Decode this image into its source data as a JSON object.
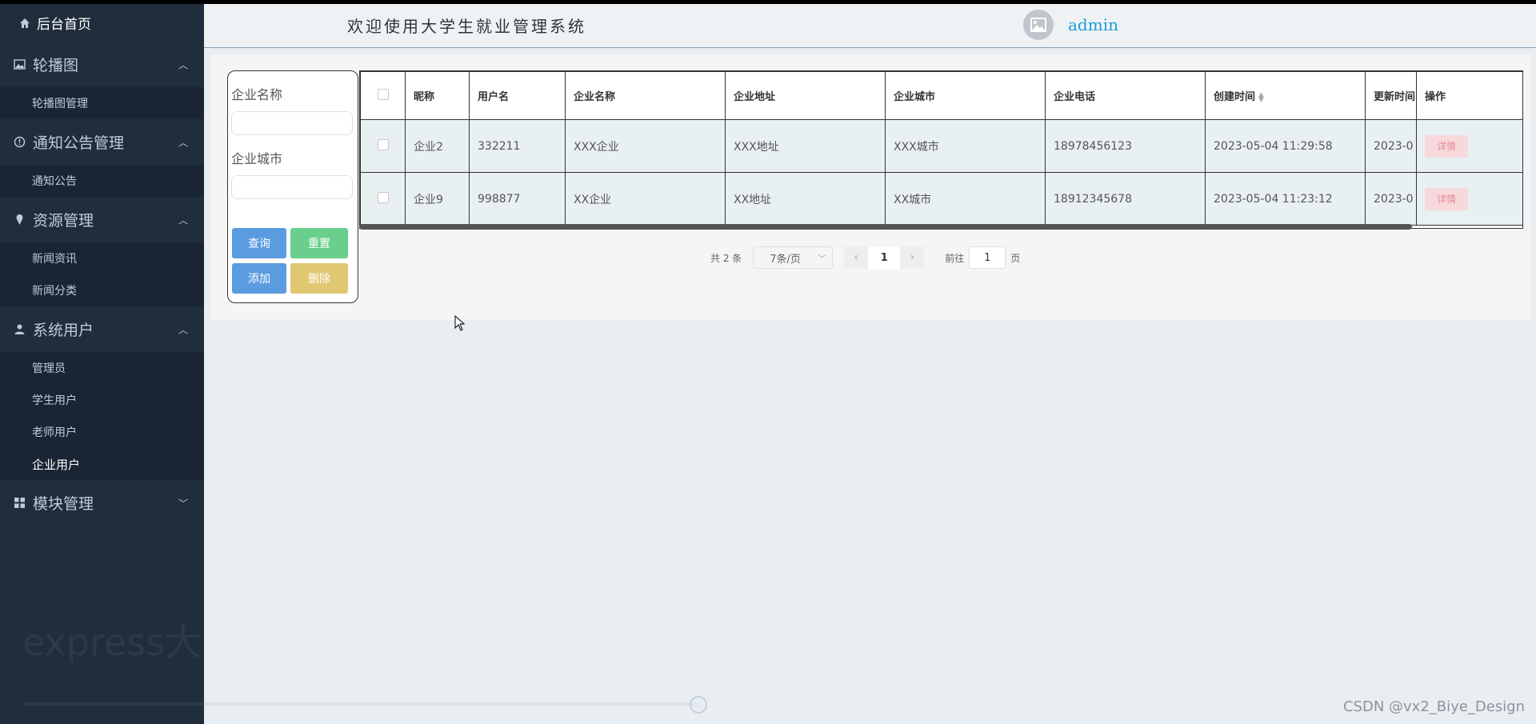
{
  "app": {
    "header_title": "欢迎使用大学生就业管理系统",
    "user_name": "admin"
  },
  "sidebar": {
    "home": "后台首页",
    "groups": [
      {
        "label": "轮播图",
        "icon": "image-icon",
        "expanded": true,
        "items": [
          "轮播图管理"
        ]
      },
      {
        "label": "通知公告管理",
        "icon": "info-circle-icon",
        "expanded": true,
        "items": [
          "通知公告"
        ]
      },
      {
        "label": "资源管理",
        "icon": "pin-icon",
        "expanded": true,
        "items": [
          "新闻资讯",
          "新闻分类"
        ]
      },
      {
        "label": "系统用户",
        "icon": "user-icon",
        "expanded": true,
        "items": [
          "管理员",
          "学生用户",
          "老师用户",
          "企业用户"
        ]
      },
      {
        "label": "模块管理",
        "icon": "grid-icon",
        "expanded": false,
        "items": []
      }
    ],
    "active_item": "企业用户",
    "watermark": "express大学生就业管理系统"
  },
  "search": {
    "company_name_label": "企业名称",
    "company_city_label": "企业城市",
    "company_name_value": "",
    "company_city_value": "",
    "query_label": "查询",
    "reset_label": "重置",
    "add_label": "添加",
    "delete_label": "删除"
  },
  "table": {
    "columns": [
      "昵称",
      "用户名",
      "企业名称",
      "企业地址",
      "企业城市",
      "企业电话",
      "创建时间",
      "更新时间",
      "操作"
    ],
    "rows": [
      {
        "nickname": "企业2",
        "username": "332211",
        "company_name": "XXX企业",
        "address": "XXX地址",
        "city": "XXX城市",
        "phone": "18978456123",
        "created": "2023-05-04 11:29:58",
        "updated": "2023-0"
      },
      {
        "nickname": "企业9",
        "username": "998877",
        "company_name": "XX企业",
        "address": "XX地址",
        "city": "XX城市",
        "phone": "18912345678",
        "created": "2023-05-04 11:23:12",
        "updated": "2023-0"
      }
    ],
    "detail_label": "详情"
  },
  "pagination": {
    "total": "共 2 条",
    "page_size": "7条/页",
    "current_page": "1",
    "goto_prefix": "前往",
    "goto_value": "1",
    "goto_suffix": "页"
  },
  "footer": {
    "credit": "CSDN @vx2_Biye_Design"
  },
  "colors": {
    "sidebar_bg": "#1f2d3d",
    "accent_blue": "#5b9be0",
    "accent_green": "#6acf8c",
    "accent_yellow": "#e0c873",
    "admin_link": "#1b9ad6"
  }
}
